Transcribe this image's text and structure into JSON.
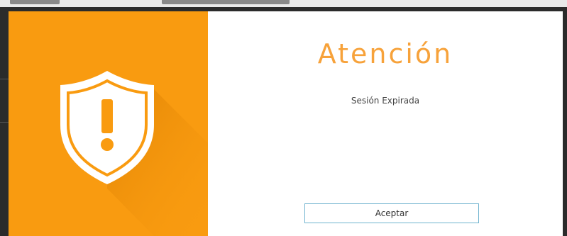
{
  "dialog": {
    "title": "Atención",
    "message": "Sesión Expirada",
    "accept_label": "Aceptar",
    "icon": "warning-shield-icon"
  },
  "colors": {
    "icon_panel": "#f99b10",
    "title": "#f7a23a",
    "button_border": "#6fb3cf",
    "overlay": "#2b2b2b"
  }
}
